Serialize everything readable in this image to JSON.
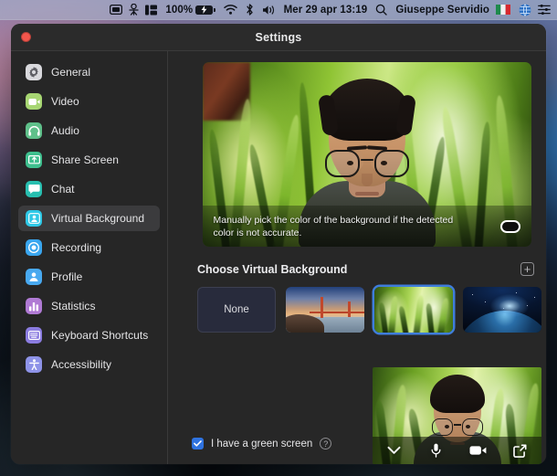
{
  "menubar": {
    "icons": [
      {
        "name": "display-mirror-icon"
      },
      {
        "name": "screen-recording-icon"
      },
      {
        "name": "stage-manager-icon"
      }
    ],
    "battery_percent": "100%",
    "battery_icon": "battery-charging-icon",
    "wifi_icon": "wifi-icon",
    "bluetooth_icon": "bluetooth-icon",
    "volume_icon": "volume-icon",
    "clock": "Mer 29 apr  13:19",
    "search_icon": "search-icon",
    "user_name": "Giuseppe Servidio",
    "flag_icon": "italy-flag-icon",
    "timemachine_icon": "globe-icon",
    "control_center_icon": "control-center-icon"
  },
  "window": {
    "title": "Settings",
    "close_button": "close-window-button"
  },
  "sidebar": {
    "items": [
      {
        "label": "General",
        "icon": "gear-icon",
        "color": "#d9d9dd",
        "selected": false
      },
      {
        "label": "Video",
        "icon": "video-camera-icon",
        "color": "#a7d672",
        "selected": false
      },
      {
        "label": "Audio",
        "icon": "headphones-icon",
        "color": "#5fc08a",
        "selected": false
      },
      {
        "label": "Share Screen",
        "icon": "share-screen-icon",
        "color": "#3fbf8e",
        "selected": false
      },
      {
        "label": "Chat",
        "icon": "chat-bubble-icon",
        "color": "#28bfb0",
        "selected": false
      },
      {
        "label": "Virtual Background",
        "icon": "virtual-background-icon",
        "color": "#2ec8e6",
        "selected": true
      },
      {
        "label": "Recording",
        "icon": "record-icon",
        "color": "#3aa6ef",
        "selected": false
      },
      {
        "label": "Profile",
        "icon": "person-icon",
        "color": "#48a9f0",
        "selected": false
      },
      {
        "label": "Statistics",
        "icon": "bar-chart-icon",
        "color": "#b07ad4",
        "selected": false
      },
      {
        "label": "Keyboard Shortcuts",
        "icon": "keyboard-icon",
        "color": "#8b7ce0",
        "selected": false
      },
      {
        "label": "Accessibility",
        "icon": "accessibility-icon",
        "color": "#8e93e8",
        "selected": false
      }
    ]
  },
  "main": {
    "preview": {
      "hint_text": "Manually pick the color of the background if the detected color is not accurate.",
      "color_picker": "background-color-swatch"
    },
    "section": {
      "title": "Choose Virtual Background",
      "add_button": "+"
    },
    "backgrounds": [
      {
        "label": "None",
        "name": "background-none",
        "selected": false
      },
      {
        "label": "",
        "name": "background-golden-gate",
        "selected": false
      },
      {
        "label": "",
        "name": "background-grass",
        "selected": true
      },
      {
        "label": "",
        "name": "background-earth",
        "selected": false
      }
    ],
    "green_screen": {
      "label": "I have a green screen",
      "checked": true,
      "help_glyph": "?"
    },
    "mini_toolbar": [
      {
        "name": "chevron-down-icon"
      },
      {
        "name": "microphone-icon"
      },
      {
        "name": "video-camera-icon"
      },
      {
        "name": "share-arrow-icon"
      }
    ]
  },
  "colors": {
    "accent_blue": "#2f73e0",
    "selection_ring": "#3f7ddb",
    "window_bg": "#272727",
    "sidebar_bg": "#262626",
    "close_red": "#f2564c"
  }
}
